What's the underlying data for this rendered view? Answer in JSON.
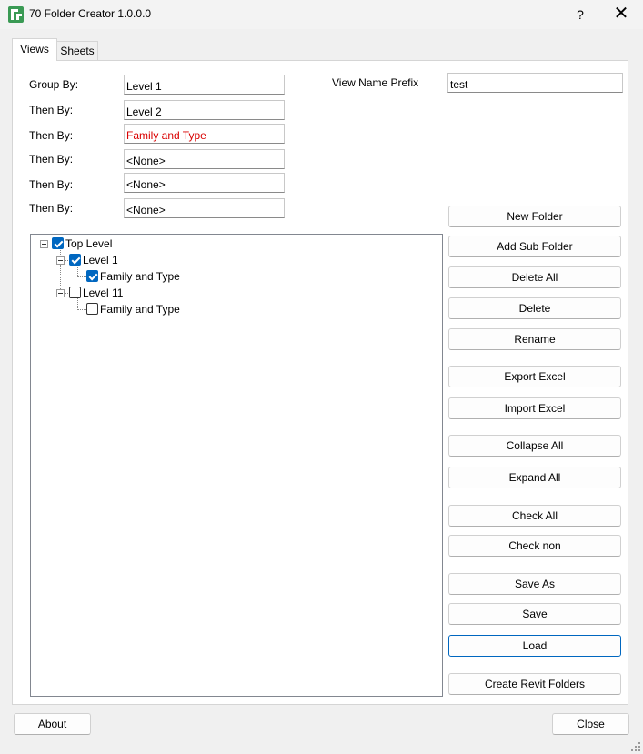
{
  "window": {
    "title": "70 Folder Creator 1.0.0.0",
    "help_label": "?",
    "close_label": "✕"
  },
  "tabs": [
    {
      "label": "Views",
      "active": true
    },
    {
      "label": "Sheets",
      "active": false
    }
  ],
  "grouping": {
    "group_by_label": "Group By:",
    "then_by_label": "Then By:",
    "values": [
      "Level 1",
      "Level 2",
      "Family and Type",
      "<None>",
      "<None>",
      "<None>"
    ]
  },
  "view_name_prefix": {
    "label": "View Name Prefix",
    "value": "test"
  },
  "tree": {
    "nodes": [
      {
        "label": "Top Level",
        "checked": true
      },
      {
        "label": "Level 1",
        "checked": true
      },
      {
        "label": "Family and Type",
        "checked": true
      },
      {
        "label": "Level 11",
        "checked": false
      },
      {
        "label": "Family and Type",
        "checked": false
      }
    ]
  },
  "actions": {
    "new_folder": "New Folder",
    "add_sub_folder": "Add Sub Folder",
    "delete_all": "Delete All",
    "delete": "Delete",
    "rename": "Rename",
    "export_excel": "Export Excel",
    "import_excel": "Import Excel",
    "collapse_all": "Collapse All",
    "expand_all": "Expand All",
    "check_all": "Check All",
    "check_non": "Check non",
    "save_as": "Save As",
    "save": "Save",
    "load": "Load",
    "create_revit_folders": "Create Revit Folders"
  },
  "footer": {
    "about": "About",
    "close": "Close"
  },
  "colors": {
    "accent": "#0067c0",
    "warning_text": "#d90000"
  }
}
